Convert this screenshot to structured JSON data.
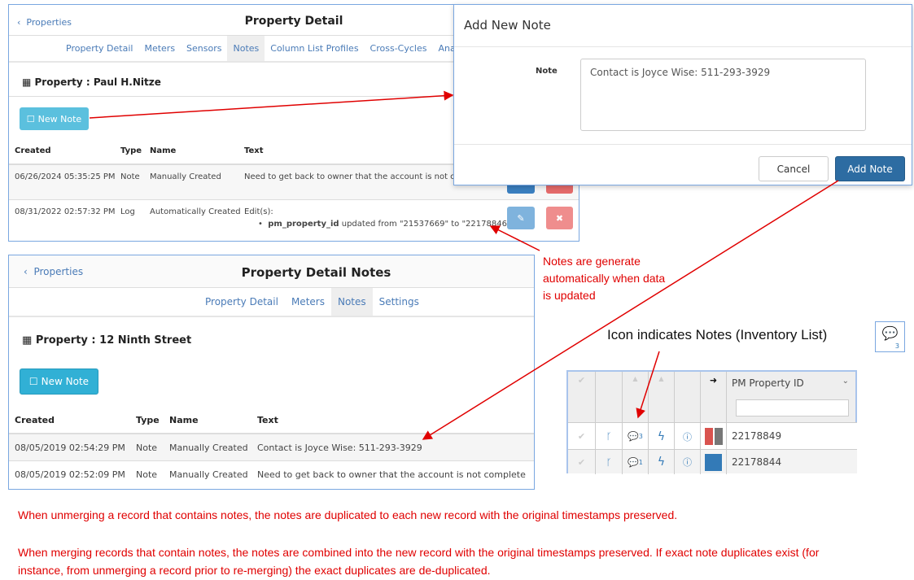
{
  "panel1": {
    "back": "Properties",
    "title": "Property Detail",
    "tabs": [
      "Property Detail",
      "Meters",
      "Sensors",
      "Notes",
      "Column List Profiles",
      "Cross-Cycles",
      "Analyses"
    ],
    "active_tab": "Notes",
    "property": "Property : Paul H.Nitze",
    "new_note": "New Note",
    "columns": [
      "Created",
      "Type",
      "Name",
      "Text"
    ],
    "rows": [
      {
        "created": "06/26/2024 05:35:25 PM",
        "type": "Note",
        "name": "Manually Created",
        "text": "Need to get back to owner that the account is not comp"
      },
      {
        "created": "08/31/2022 02:57:32 PM",
        "type": "Log",
        "name": "Automatically Created",
        "text": "Edit(s):",
        "field": "pm_property_id",
        "change": "updated from \"21537669\" to \"22178846\""
      }
    ]
  },
  "modal": {
    "title": "Add New Note",
    "label": "Note",
    "value": "Contact is Joyce Wise: 511-293-3929",
    "cancel": "Cancel",
    "add": "Add Note"
  },
  "panel2": {
    "back": "Properties",
    "title": "Property Detail Notes",
    "tabs": [
      "Property Detail",
      "Meters",
      "Notes",
      "Settings"
    ],
    "active_tab": "Notes",
    "property": "Property : 12 Ninth Street",
    "new_note": "New Note",
    "columns": [
      "Created",
      "Type",
      "Name",
      "Text"
    ],
    "rows": [
      {
        "created": "08/05/2019 02:54:29 PM",
        "type": "Note",
        "name": "Manually Created",
        "text": "Contact is Joyce Wise: 511-293-3929"
      },
      {
        "created": "08/05/2019 02:52:09 PM",
        "type": "Note",
        "name": "Manually Created",
        "text": "Need to get back to owner that the account is not complete"
      }
    ]
  },
  "annotations": {
    "auto": "Notes are generate automatically when data is updated",
    "icon": "Icon indicates Notes (Inventory List)",
    "icon_count": "3",
    "unmerge": "When unmerging a record that contains notes, the notes are duplicated to each new record with the original timestamps preserved.",
    "merge": "When merging records that contain notes, the notes are combined into the new record with the original timestamps preserved. If exact note duplicates exist (for instance, from unmerging a record prior to re-merging) the exact duplicates are de-duplicated."
  },
  "inventory": {
    "column": "PM Property ID",
    "rows": [
      {
        "id": "22178849",
        "notes": "3"
      },
      {
        "id": "22178844",
        "notes": "1"
      }
    ]
  },
  "colors": {
    "accent": "#337ab7",
    "annotation": "#e00000",
    "new_note_btn": "#5bc0de",
    "add_btn": "#2d6ca2"
  }
}
